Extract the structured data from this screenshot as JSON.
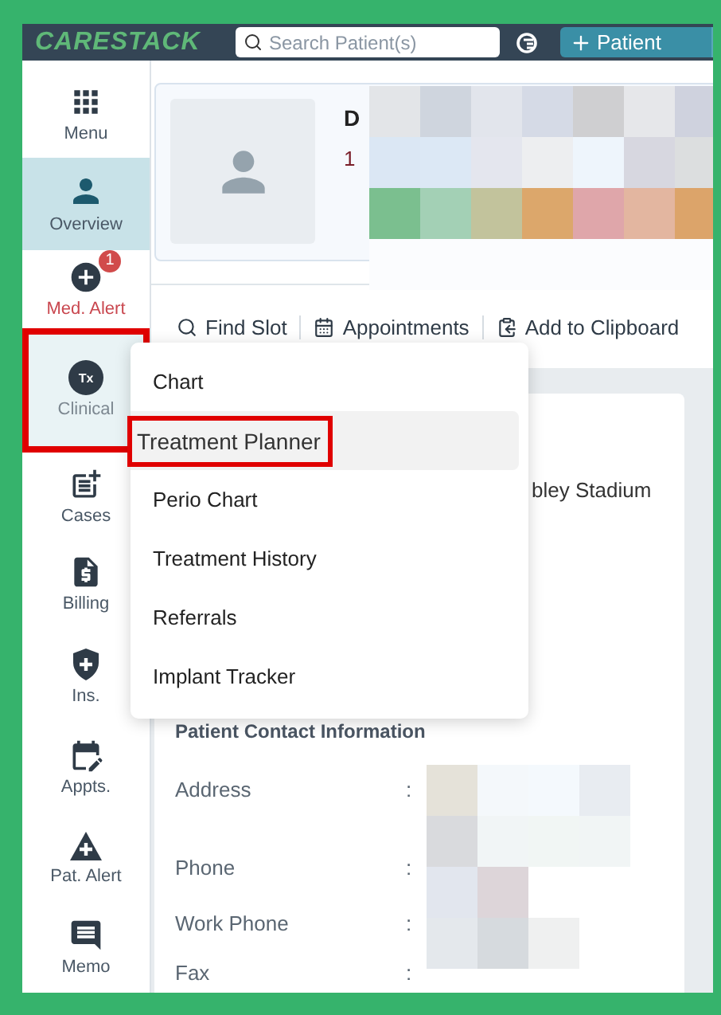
{
  "header": {
    "logo": "CARESTACK",
    "search": {
      "placeholder": "Search Patient(s)"
    },
    "add_button": "Patient"
  },
  "sidebar": {
    "items": [
      {
        "label": "Menu",
        "kind": "grid",
        "selected": false,
        "open": false,
        "alert": false,
        "annotated": false
      },
      {
        "label": "Overview",
        "kind": "person",
        "selected": true,
        "open": false,
        "alert": false,
        "annotated": false
      },
      {
        "label": "Med. Alert",
        "kind": "plus-circle",
        "selected": false,
        "open": false,
        "alert": true,
        "annotated": false,
        "badge": "1"
      },
      {
        "label": "Clinical",
        "kind": "tx",
        "selected": false,
        "open": true,
        "alert": false,
        "annotated": true,
        "glyph": "Tx"
      },
      {
        "label": "Cases",
        "kind": "clipboard",
        "selected": false,
        "open": false,
        "alert": false,
        "annotated": false
      },
      {
        "label": "Billing",
        "kind": "bill",
        "selected": false,
        "open": false,
        "alert": false,
        "annotated": false
      },
      {
        "label": "Ins.",
        "kind": "shield",
        "selected": false,
        "open": false,
        "alert": false,
        "annotated": false
      },
      {
        "label": "Appts.",
        "kind": "calendar",
        "selected": false,
        "open": false,
        "alert": false,
        "annotated": false
      },
      {
        "label": "Pat. Alert",
        "kind": "warning",
        "selected": false,
        "open": false,
        "alert": false,
        "annotated": false
      },
      {
        "label": "Memo",
        "kind": "memo",
        "selected": false,
        "open": false,
        "alert": false,
        "annotated": false
      }
    ]
  },
  "patient": {
    "name_fragment": "D",
    "info_fragment": "1"
  },
  "toolbar": [
    {
      "label": "Find Slot",
      "kind": "search"
    },
    {
      "label": "Appointments",
      "kind": "calendar"
    },
    {
      "label": "Add to Clipboard",
      "kind": "clipboard"
    }
  ],
  "dropdown": {
    "items": [
      {
        "label": "Chart",
        "hovered": false,
        "annotated": false
      },
      {
        "label": "Treatment Planner",
        "hovered": true,
        "annotated": true
      },
      {
        "label": "Perio Chart",
        "hovered": false,
        "annotated": false
      },
      {
        "label": "Treatment History",
        "hovered": false,
        "annotated": false
      },
      {
        "label": "Referrals",
        "hovered": false,
        "annotated": false
      },
      {
        "label": "Implant Tracker",
        "hovered": false,
        "annotated": false
      }
    ]
  },
  "details": {
    "address_fragment": "bley Stadium",
    "contact": {
      "title": "Patient Contact Information",
      "rows": [
        {
          "label": "Address",
          "separator": ":"
        },
        {
          "label": "Phone",
          "separator": ":"
        },
        {
          "label": "Work Phone",
          "separator": ":"
        },
        {
          "label": "Fax",
          "separator": ":"
        }
      ]
    }
  }
}
